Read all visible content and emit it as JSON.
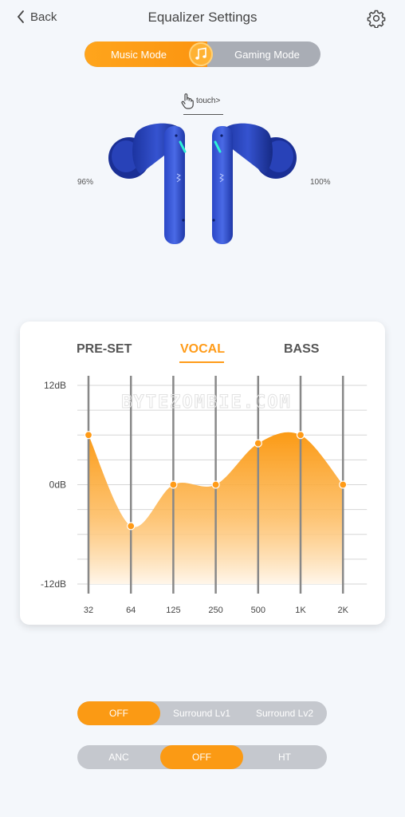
{
  "header": {
    "back_label": "Back",
    "title": "Equalizer Settings"
  },
  "mode": {
    "left_label": "Music Mode",
    "right_label": "Gaming Mode",
    "selected": "Music Mode"
  },
  "touch_label": "touch>",
  "battery": {
    "left": "96%",
    "right": "100%"
  },
  "eq": {
    "tabs": [
      "PRE-SET",
      "VOCAL",
      "BASS"
    ],
    "active_tab": "VOCAL",
    "watermark": "BYTEZOMBIE.COM",
    "accent_color": "#ff9b18"
  },
  "chart_data": {
    "type": "area",
    "categories": [
      "32",
      "64",
      "125",
      "250",
      "500",
      "1K",
      "2K"
    ],
    "values": [
      6,
      -5,
      0,
      0,
      5,
      6,
      0
    ],
    "y_tick_labels": [
      "12dB",
      "0dB",
      "-12dB"
    ],
    "ylim": [
      -12,
      12
    ],
    "grid": true
  },
  "surround": {
    "options": [
      "OFF",
      "Surround Lv1",
      "Surround Lv2"
    ],
    "selected": "OFF"
  },
  "anc": {
    "options": [
      "ANC",
      "OFF",
      "HT"
    ],
    "selected": "OFF"
  }
}
